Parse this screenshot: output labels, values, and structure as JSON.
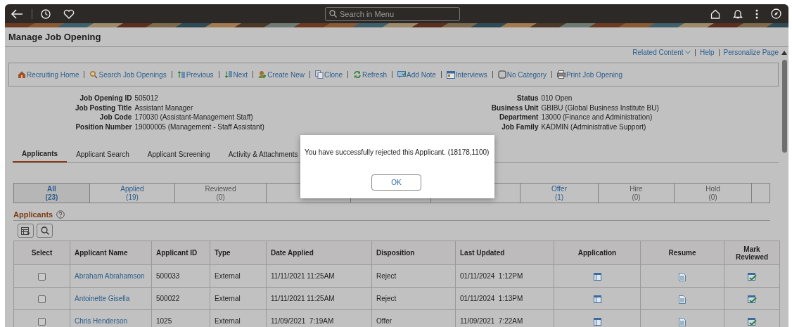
{
  "header": {
    "search": {
      "placeholder": "Search in Menu"
    }
  },
  "page": {
    "title": "Manage Job Opening"
  },
  "page_links": [
    {
      "label": "Related Content",
      "kind": "dropdown"
    },
    {
      "label": "Help",
      "kind": "link"
    },
    {
      "label": "Personalize Page",
      "kind": "link"
    }
  ],
  "toolbar": [
    {
      "label": "Recruiting Home",
      "kind": "home"
    },
    {
      "label": "Search Job Openings",
      "kind": "search"
    },
    {
      "label": "Previous",
      "kind": "previous"
    },
    {
      "label": "Next",
      "kind": "next"
    },
    {
      "label": "Create New",
      "kind": "create"
    },
    {
      "label": "Clone",
      "kind": "clone"
    },
    {
      "label": "Refresh",
      "kind": "refresh"
    },
    {
      "label": "Add Note",
      "kind": "note"
    },
    {
      "label": "Interviews",
      "kind": "calendar"
    },
    {
      "label": "No Category",
      "kind": "category"
    },
    {
      "label": "Print Job Opening",
      "kind": "print"
    }
  ],
  "details_left": [
    {
      "label": "Job Opening ID",
      "value": "505012"
    },
    {
      "label": "Job Posting Title",
      "value": "Assistant Manager"
    },
    {
      "label": "Job Code",
      "value": "170030 (Assistant-Management Staff)"
    },
    {
      "label": "Position Number",
      "value": "19000005 (Management - Staff Assistant)"
    }
  ],
  "details_right": [
    {
      "label": "Status",
      "value": "010 Open"
    },
    {
      "label": "Business Unit",
      "value": "GBIBU (Global Business Institute BU)"
    },
    {
      "label": "Department",
      "value": "13000 (Finance and Administration)"
    },
    {
      "label": "Job Family",
      "value": "KADMIN (Administrative Support)"
    }
  ],
  "tabs": [
    {
      "label": "Applicants",
      "selected": true
    },
    {
      "label": "Applicant Search",
      "selected": false
    },
    {
      "label": "Applicant Screening",
      "selected": false
    },
    {
      "label": "Activity & Attachments",
      "selected": false
    }
  ],
  "status_filters": [
    {
      "label": "All",
      "count": "(23)",
      "kind": "active",
      "selected": true
    },
    {
      "label": "Applied",
      "count": "(19)",
      "kind": "active",
      "selected": false
    },
    {
      "label": "Reviewed",
      "count": "(0)",
      "kind": "inactive",
      "selected": false
    },
    {
      "kind": "hidden"
    },
    {
      "kind": "hidden"
    },
    {
      "kind": "hidden"
    },
    {
      "label": "Offer",
      "count": "(1)",
      "kind": "active",
      "selected": false
    },
    {
      "label": "Hire",
      "count": "(0)",
      "kind": "inactive",
      "selected": false
    },
    {
      "label": "Hold",
      "count": "(0)",
      "kind": "inactive",
      "selected": false
    },
    {
      "kind": "empty"
    }
  ],
  "applicants": {
    "title": "Applicants",
    "columns": [
      "Select",
      "Applicant Name",
      "Applicant ID",
      "Type",
      "Date Applied",
      "Disposition",
      "Last Updated",
      "Application",
      "Resume",
      "Mark Reviewed"
    ],
    "rows": [
      {
        "checked": false,
        "name": "Abraham Abrahamson",
        "id": "500033",
        "type": "External",
        "date_applied": "11/11/2021 11:25AM",
        "disposition": "Reject",
        "last_updated": "01/11/2024  1:12PM"
      },
      {
        "checked": false,
        "name": "Antoinette Gisella",
        "id": "500022",
        "type": "External",
        "date_applied": "11/11/2021 11:25AM",
        "disposition": "Reject",
        "last_updated": "01/11/2024  1:13PM"
      },
      {
        "checked": false,
        "name": "Chris Henderson",
        "id": "1025",
        "type": "External",
        "date_applied": "11/09/2021  7:19AM",
        "disposition": "Offer",
        "last_updated": "11/09/2021  7:22AM"
      }
    ]
  },
  "dialog": {
    "message": "You have successfully rejected this Applicant. (18178,1100)",
    "button": "OK"
  }
}
